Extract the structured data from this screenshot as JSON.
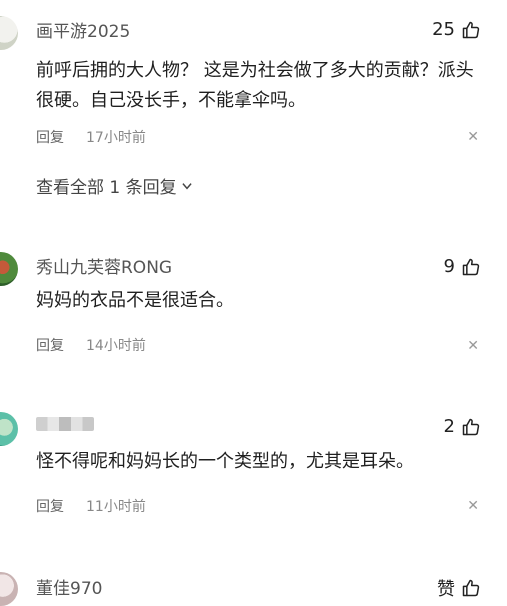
{
  "comments": [
    {
      "username": "画平游2025",
      "likes": "25",
      "text": "前呼后拥的大人物？ 这是为社会做了多大的贡献？派头很硬。自己没长手，不能拿伞吗。",
      "reply_label": "回复",
      "time": "17小时前",
      "view_replies": "查看全部 1 条回复"
    },
    {
      "username": "秀山九芙蓉RONG",
      "likes": "9",
      "text": "妈妈的衣品不是很适合。",
      "reply_label": "回复",
      "time": "14小时前"
    },
    {
      "username": "",
      "likes": "2",
      "text": "怪不得呢和妈妈长的一个类型的，尤其是耳朵。",
      "reply_label": "回复",
      "time": "11小时前"
    },
    {
      "username": "董佳970",
      "likes": "赞"
    }
  ],
  "icons": {
    "like": "thumbs-up-icon",
    "close": "close-icon",
    "expand": "chevron-down-icon"
  }
}
